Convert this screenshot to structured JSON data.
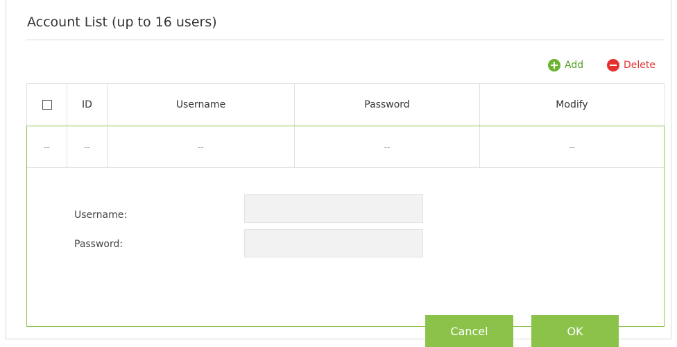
{
  "panel": {
    "title": "Account List (up to 16 users)"
  },
  "toolbar": {
    "add_label": "Add",
    "delete_label": "Delete",
    "add_icon": "plus-circle-icon",
    "delete_icon": "minus-circle-icon",
    "add_color": "#6ab42f",
    "delete_color": "#e3312f"
  },
  "table": {
    "columns": [
      "",
      "ID",
      "Username",
      "Password",
      "Modify"
    ],
    "rows": [
      [
        "--",
        "--",
        "--",
        "--",
        "--"
      ]
    ]
  },
  "form": {
    "username_label": "Username:",
    "password_label": "Password:",
    "username_value": "",
    "password_value": "",
    "cancel_label": "Cancel",
    "ok_label": "OK"
  },
  "colors": {
    "accent_green": "#8bc34a",
    "border": "#e1e1e1"
  }
}
